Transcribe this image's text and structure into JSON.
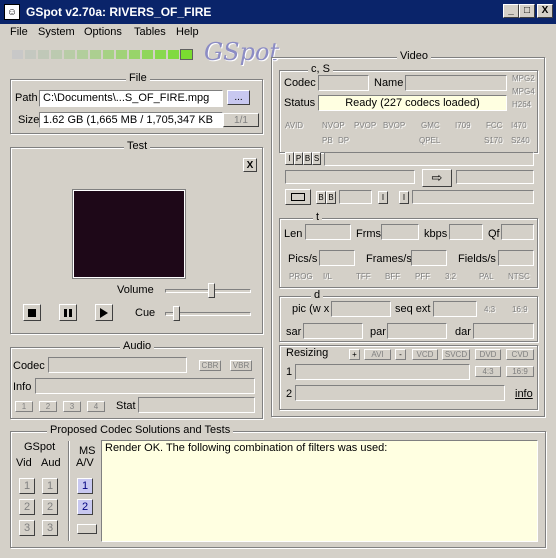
{
  "window": {
    "title": "GSpot v2.70a: RIVERS_OF_FIRE",
    "minimize": "_",
    "maximize": "□",
    "close": "X"
  },
  "menu": [
    {
      "label": "File"
    },
    {
      "label": "System"
    },
    {
      "label": "Options"
    },
    {
      "label": "Tables"
    },
    {
      "label": "Help"
    }
  ],
  "logo": "GSpot",
  "file": {
    "title": "File",
    "path_label": "Path",
    "path_value": "C:\\Documents\\...S_OF_FIRE.mpg",
    "browse": "...",
    "size_label": "Size",
    "size_value": "1.62 GB (1,665 MB / 1,705,347 KB",
    "page": "1/1"
  },
  "test": {
    "title": "Test",
    "close": "X",
    "volume_label": "Volume",
    "cue_label": "Cue",
    "volume_level": 0.55,
    "cue_level": 0.1
  },
  "audio": {
    "title": "Audio",
    "codec_label": "Codec",
    "cbr": "CBR",
    "vbr": "VBR",
    "info_label": "Info",
    "stat_label": "Stat",
    "buttons": [
      "1",
      "2",
      "3",
      "4"
    ]
  },
  "video": {
    "title": "Video",
    "cs_title": "c, S",
    "codec_label": "Codec",
    "name_label": "Name",
    "status_label": "Status",
    "status_value": "Ready (227 codecs loaded)",
    "mpg_flags": [
      "MPG2",
      "MPG4",
      "H264"
    ],
    "flags_row1": [
      "AVID",
      "NVOP",
      "PVOP",
      "BVOP",
      "GMC",
      "I709",
      "FCC",
      "I470"
    ],
    "flags_row2": [
      "PB",
      "DP",
      "QPEL",
      "S170",
      "S240"
    ],
    "ipbs": [
      "I",
      "P",
      "B",
      "S"
    ],
    "b_buttons": [
      "B",
      "B"
    ],
    "i_buttons": [
      "I",
      "I"
    ],
    "t_title": "t",
    "len_label": "Len",
    "frms_label": "Frms",
    "kbps_label": "kbps",
    "qf_label": "Qf",
    "pics_label": "Pics/s",
    "frames_label": "Frames/s",
    "fields_label": "Fields/s",
    "scan_flags": [
      "PROG",
      "I/L",
      "TFF",
      "BFF",
      "PFF",
      "3:2",
      "PAL",
      "NTSC"
    ],
    "d_title": "d",
    "pic_label": "pic (w x",
    "seqext_label": "seq ext",
    "ratio_43": "4:3",
    "ratio_169": "16:9",
    "sar_label": "sar",
    "par_label": "par",
    "dar_label": "dar",
    "resizing_label": "Resizing",
    "plus": "+",
    "avi": "AVI",
    "minus": "-",
    "vcd": "VCD",
    "svcd": "SVCD",
    "dvd": "DVD",
    "cvd": "CVD",
    "row1": "1",
    "row2": "2",
    "ratio2_43": "4:3",
    "ratio2_169": "16:9",
    "info_link": "info"
  },
  "proposed": {
    "title": "Proposed Codec Solutions and Tests",
    "gspot_label": "GSpot",
    "vid_label": "Vid",
    "aud_label": "Aud",
    "ms_label": "MS",
    "av_label": "A/V",
    "buttons": [
      "1",
      "2",
      "3"
    ],
    "ms_buttons": [
      "1",
      "2"
    ],
    "render_text": "Render OK. The following combination of filters was used:"
  }
}
